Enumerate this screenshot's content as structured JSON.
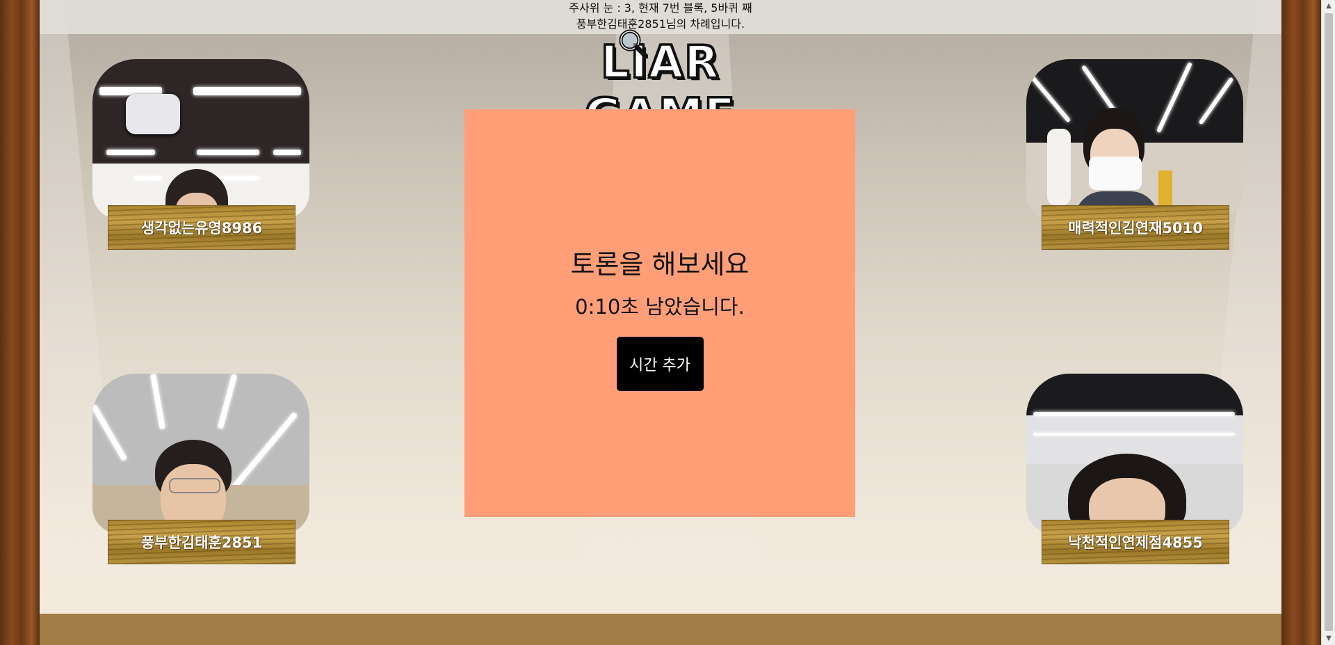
{
  "topbar": {
    "dice_info": "주사위 눈 : 3, 현재 7번 블록, 5바퀴 째",
    "turn_info": "풍부한김태훈2851님의 차례입니다."
  },
  "logo": {
    "text": "LIAR GAME",
    "icon": "magnifier-icon"
  },
  "panel": {
    "title": "토론을 해보세요",
    "timer": "0:10초 남았습니다.",
    "add_time_label": "시간 추가",
    "color": "#ff9e77"
  },
  "players": [
    {
      "name": "생각없는유영8986",
      "position": "top-left"
    },
    {
      "name": "매력적인김연재5010",
      "position": "top-right"
    },
    {
      "name": "풍부한김태훈2851",
      "position": "bottom-left"
    },
    {
      "name": "낙천적인연제점4855",
      "position": "bottom-right"
    }
  ],
  "colors": {
    "curtain": "#6b3816",
    "floor": "#a07c46",
    "panel": "#ff9e77",
    "button": "#000000"
  }
}
